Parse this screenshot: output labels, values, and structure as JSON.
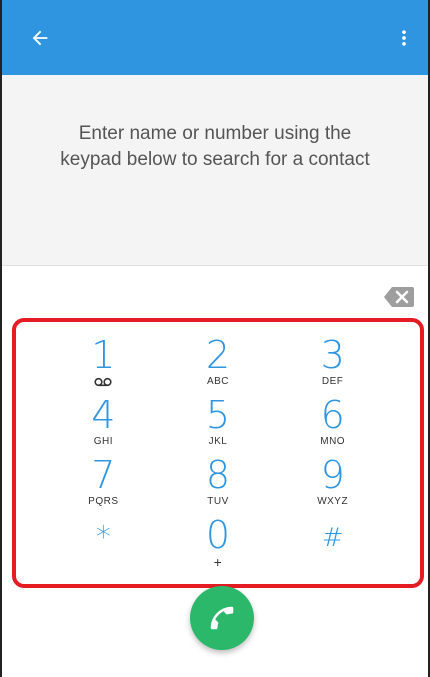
{
  "appbar": {
    "back_icon": "arrow-back-icon",
    "more_icon": "more-vert-icon",
    "color": "#2f95e0"
  },
  "search": {
    "hint": "Enter name or number using the keypad below to search for a contact"
  },
  "dialpad": {
    "backspace_icon": "backspace-icon",
    "keys": [
      {
        "digit": "1",
        "letters": "",
        "icon": "voicemail-icon"
      },
      {
        "digit": "2",
        "letters": "ABC"
      },
      {
        "digit": "3",
        "letters": "DEF"
      },
      {
        "digit": "4",
        "letters": "GHI"
      },
      {
        "digit": "5",
        "letters": "JKL"
      },
      {
        "digit": "6",
        "letters": "MNO"
      },
      {
        "digit": "7",
        "letters": "PQRS"
      },
      {
        "digit": "8",
        "letters": "TUV"
      },
      {
        "digit": "9",
        "letters": "WXYZ"
      },
      {
        "digit": "*",
        "letters": ""
      },
      {
        "digit": "0",
        "letters": "+"
      },
      {
        "digit": "#",
        "letters": ""
      }
    ],
    "highlight_color": "#e51c23"
  },
  "call_button": {
    "icon": "phone-icon",
    "color": "#2cb86a"
  }
}
